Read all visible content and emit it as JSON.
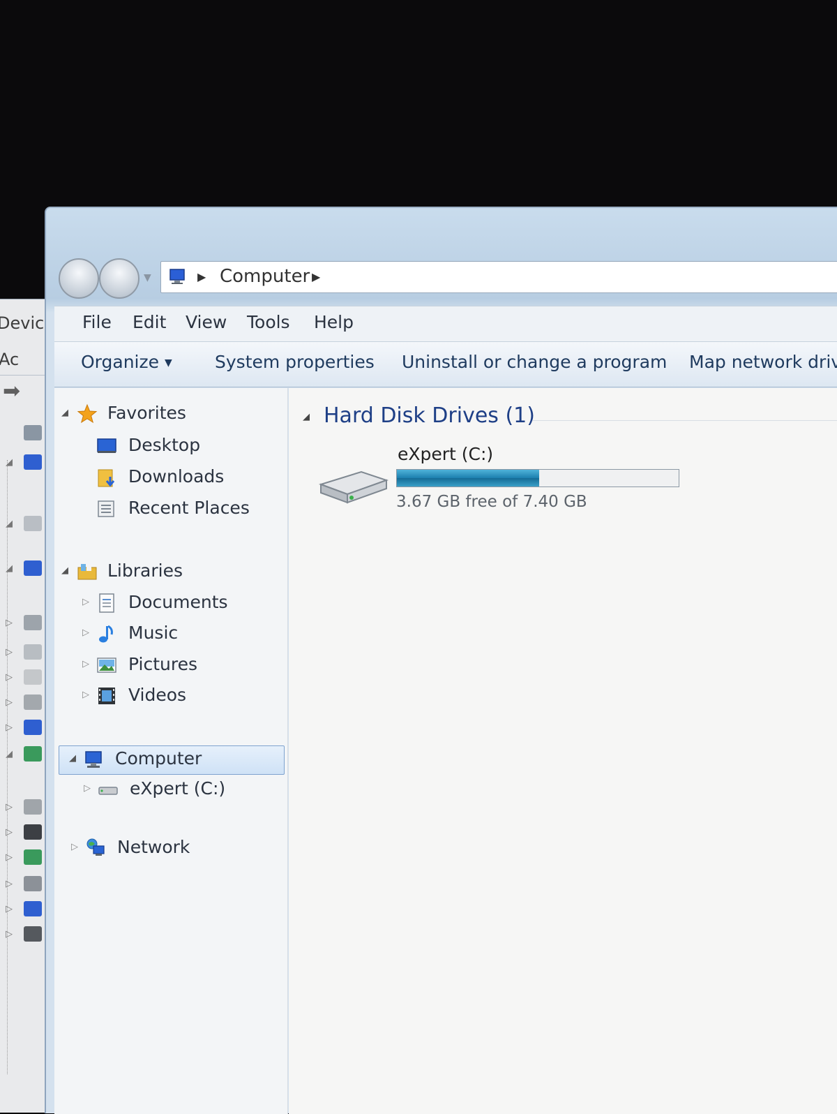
{
  "background_window": {
    "title_fragment": "Device",
    "menu_fragment": "Ac"
  },
  "address": {
    "path": [
      "Computer"
    ]
  },
  "menu": {
    "items": [
      "File",
      "Edit",
      "View",
      "Tools",
      "Help"
    ]
  },
  "toolbar": {
    "organize": "Organize",
    "system_properties": "System properties",
    "uninstall": "Uninstall or change a program",
    "map_network": "Map network driv"
  },
  "navpane": {
    "favorites": {
      "label": "Favorites",
      "items": [
        "Desktop",
        "Downloads",
        "Recent Places"
      ]
    },
    "libraries": {
      "label": "Libraries",
      "items": [
        "Documents",
        "Music",
        "Pictures",
        "Videos"
      ]
    },
    "computer": {
      "label": "Computer",
      "items": [
        "eXpert (C:)"
      ]
    },
    "network": {
      "label": "Network"
    }
  },
  "content": {
    "group_title": "Hard Disk Drives (1)",
    "drive": {
      "name": "eXpert (C:)",
      "free_text": "3.67 GB free of 7.40 GB",
      "used_fraction": 0.504
    }
  },
  "colors": {
    "accent_title": "#1e3f86",
    "usage_bar": "#1c7fae",
    "selection": "#cfe2f6"
  }
}
